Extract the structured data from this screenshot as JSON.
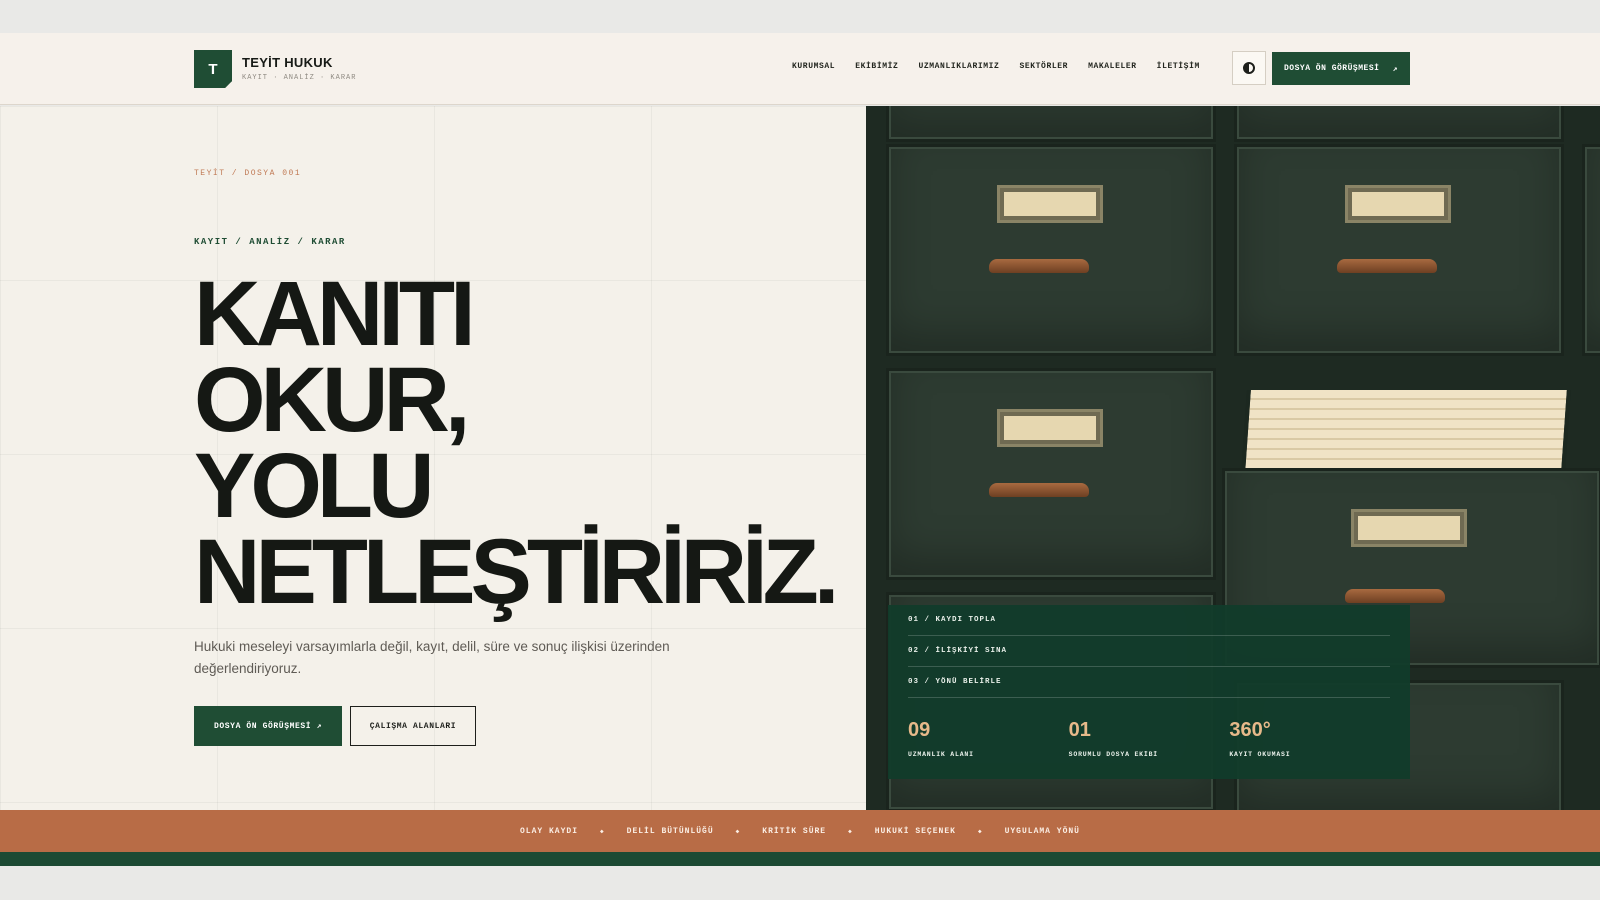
{
  "brand": {
    "logo_letter": "T",
    "name": "TEYİT HUKUK",
    "tagline": "KAYIT · ANALİZ · KARAR"
  },
  "nav": {
    "items": [
      "KURUMSAL",
      "EKİBİMİZ",
      "UZMANLIKLARIMIZ",
      "SEKTÖRLER",
      "MAKALELER",
      "İLETİŞİM"
    ]
  },
  "header": {
    "cta_label": "DOSYA ÖN GÖRÜŞMESİ",
    "cta_arrow": "↗",
    "theme_icon": "contrast-icon"
  },
  "hero": {
    "crumb": "TEYİT / DOSYA 001",
    "eyebrow": "KAYIT / ANALİZ / KARAR",
    "headline": [
      "KANITI",
      "OKUR,",
      "YOLU",
      "NETLEŞTİRİRİZ."
    ],
    "lead": "Hukuki meseleyi varsayımlarla değil, kayıt, delil, süre ve sonuç ilişkisi üzerinden değerlendiriyoruz.",
    "primary_button": "DOSYA ÖN GÖRÜŞMESİ ↗",
    "secondary_button": "ÇALIŞMA ALANLARI"
  },
  "steps": [
    "01 / KAYDI TOPLA",
    "02 / İLİŞKİYİ SINA",
    "03 / YÖNÜ BELİRLE"
  ],
  "stats": [
    {
      "value": "09",
      "label": "UZMANLIK ALANI"
    },
    {
      "value": "01",
      "label": "SORUMLU DOSYA EKİBİ"
    },
    {
      "value": "360°",
      "label": "KAYIT OKUMASI"
    }
  ],
  "ribbon": [
    "OLAY KAYDI",
    "DELİL BÜTÜNLÜĞÜ",
    "KRİTİK SÜRE",
    "HUKUKİ SEÇENEK",
    "UYGULAMA YÖNÜ"
  ],
  "colors": {
    "brand_green": "#1f4d34",
    "accent_copper": "#b86c46",
    "paper": "#f4f1ea"
  }
}
